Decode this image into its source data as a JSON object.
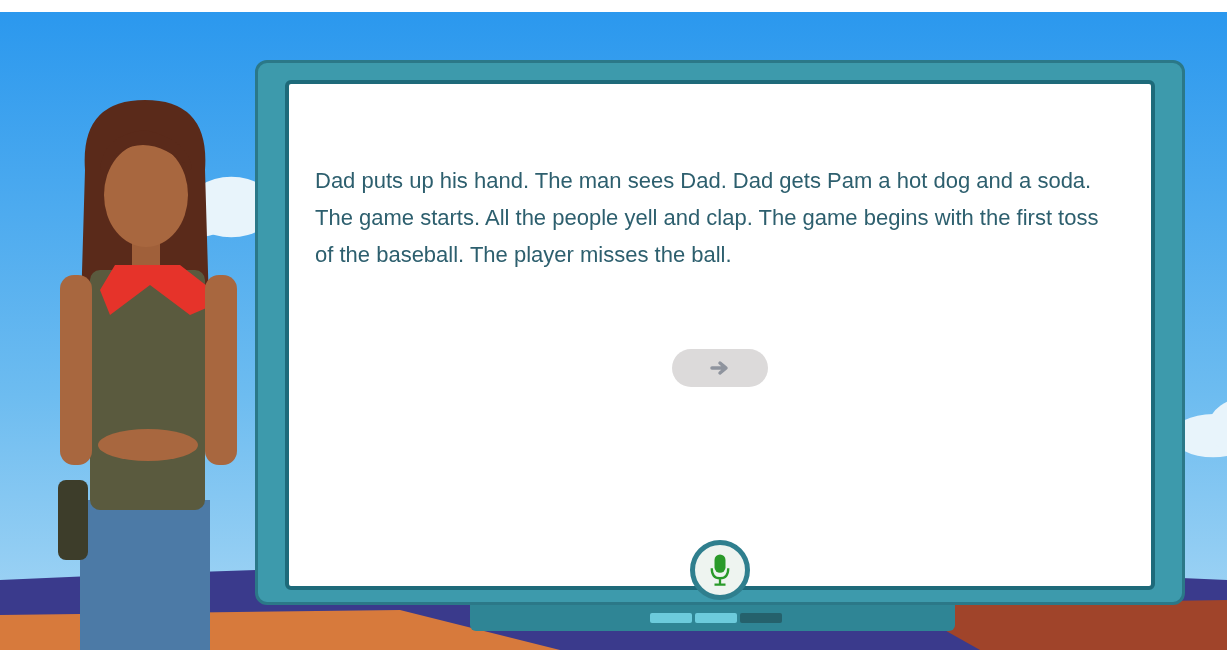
{
  "passage": {
    "text": "Dad puts up his hand. The man sees Dad. Dad gets Pam a hot dog and a soda. The game starts. All the people yell and clap. The game begins with the first toss of the baseball. The player misses the ball."
  },
  "next_button": {
    "disabled": true
  },
  "progress": [
    {
      "done": true
    },
    {
      "done": true
    },
    {
      "done": false
    }
  ]
}
